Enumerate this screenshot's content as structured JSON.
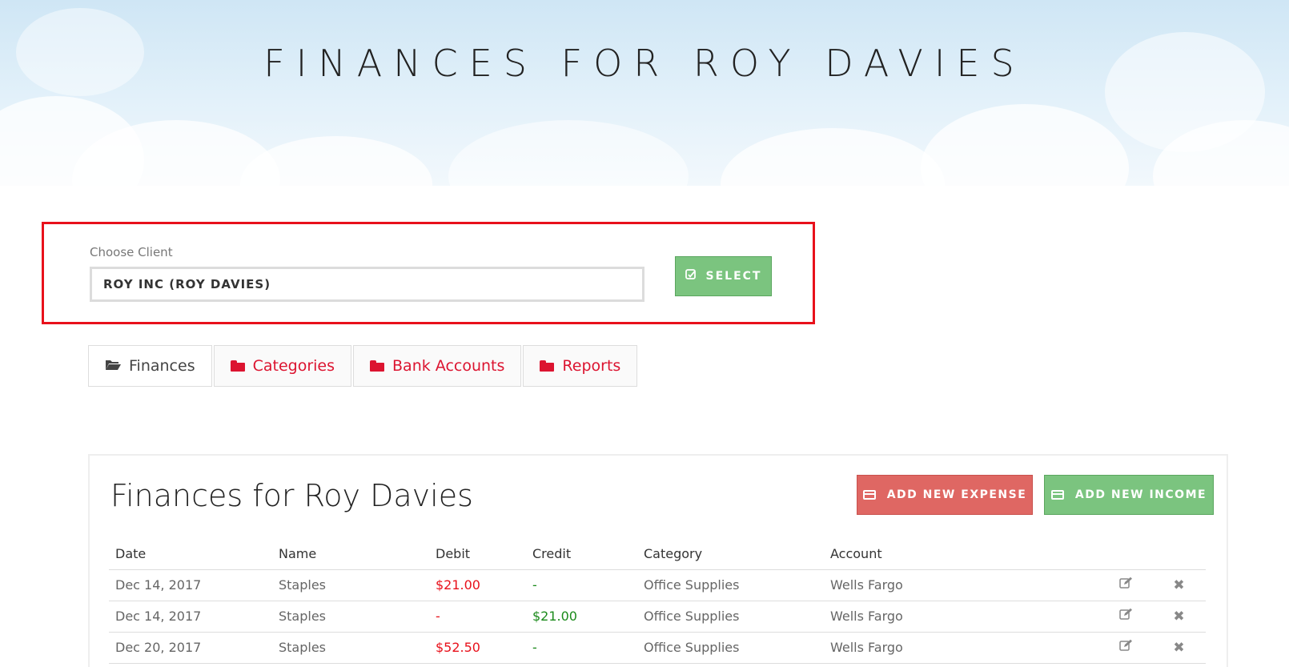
{
  "header": {
    "title": "FINANCES FOR ROY DAVIES"
  },
  "client_picker": {
    "label": "Choose Client",
    "selected": "ROY INC (ROY DAVIES)",
    "select_button": "SELECT"
  },
  "tabs": [
    {
      "label": "Finances",
      "active": true
    },
    {
      "label": "Categories",
      "active": false
    },
    {
      "label": "Bank Accounts",
      "active": false
    },
    {
      "label": "Reports",
      "active": false
    }
  ],
  "panel": {
    "title": "Finances for Roy Davies",
    "add_expense": "ADD NEW EXPENSE",
    "add_income": "ADD NEW INCOME"
  },
  "table": {
    "columns": [
      "Date",
      "Name",
      "Debit",
      "Credit",
      "Category",
      "Account"
    ],
    "rows": [
      {
        "date": "Dec 14, 2017",
        "name": "Staples",
        "debit": "$21.00",
        "credit": "-",
        "category": "Office Supplies",
        "account": "Wells Fargo"
      },
      {
        "date": "Dec 14, 2017",
        "name": "Staples",
        "debit": "-",
        "credit": "$21.00",
        "category": "Office Supplies",
        "account": "Wells Fargo"
      },
      {
        "date": "Dec 20, 2017",
        "name": "Staples",
        "debit": "$52.50",
        "credit": "-",
        "category": "Office Supplies",
        "account": "Wells Fargo"
      }
    ]
  },
  "icons": {
    "edit": "edit-icon",
    "delete": "close-icon",
    "check": "check-square-icon",
    "card": "credit-card-icon",
    "folder": "folder-icon"
  },
  "colors": {
    "accent_red": "#dc1430",
    "highlight_border": "#e8111b",
    "success_green": "#7bc47f",
    "danger_red": "#df6763",
    "credit_green": "#1b8a1b"
  }
}
